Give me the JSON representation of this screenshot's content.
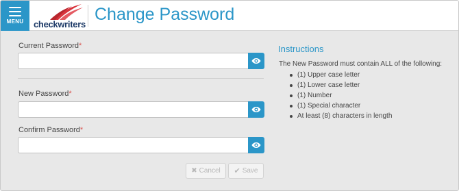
{
  "header": {
    "menu_label": "MENU",
    "logo_text": "checkwriters",
    "title": "Change Password"
  },
  "form": {
    "current_password": {
      "label": "Current Password",
      "required_mark": "*",
      "value": ""
    },
    "new_password": {
      "label": "New Password",
      "required_mark": "*",
      "value": ""
    },
    "confirm_password": {
      "label": "Confirm Password",
      "required_mark": "*",
      "value": ""
    },
    "cancel_label": "Cancel",
    "save_label": "Save"
  },
  "instructions": {
    "title": "Instructions",
    "intro": "The New Password must contain ALL of the following:",
    "items": [
      "(1) Upper case letter",
      "(1) Lower case letter",
      "(1) Number",
      "(1) Special character",
      "At least (8) characters in length"
    ]
  },
  "colors": {
    "accent": "#2b96c8",
    "required": "#d9534f",
    "logo_red": "#d9343d",
    "logo_navy": "#1d3a67"
  },
  "icons": {
    "menu": "hamburger-icon",
    "show_password": "eye-icon",
    "cancel": "close-icon",
    "save": "check-icon"
  }
}
